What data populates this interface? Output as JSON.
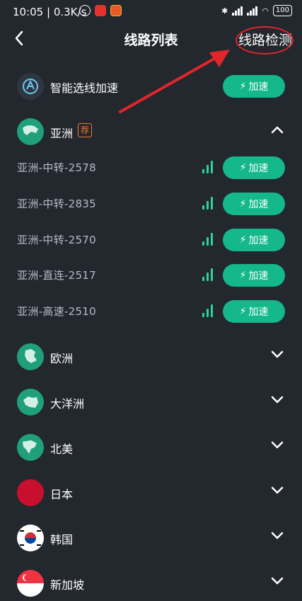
{
  "status_bar": {
    "time": "10:05",
    "speed": "0.3K/s",
    "battery": "100"
  },
  "header": {
    "title": "线路列表",
    "detect_label": "线路检测"
  },
  "smart": {
    "label": "智能选线加速",
    "button_label": "加速"
  },
  "regions": [
    {
      "label": "亚洲",
      "tag": "荐",
      "expanded": true,
      "lines": [
        {
          "label": "亚洲-中转-2578",
          "button_label": "加速"
        },
        {
          "label": "亚洲-中转-2835",
          "button_label": "加速"
        },
        {
          "label": "亚洲-中转-2570",
          "button_label": "加速"
        },
        {
          "label": "亚洲-直连-2517",
          "button_label": "加速"
        },
        {
          "label": "亚洲-高速-2510",
          "button_label": "加速"
        }
      ]
    },
    {
      "label": "欧洲",
      "expanded": false
    },
    {
      "label": "大洋洲",
      "expanded": false
    },
    {
      "label": "北美",
      "expanded": false
    },
    {
      "label": "日本",
      "expanded": false
    },
    {
      "label": "韩国",
      "expanded": false
    },
    {
      "label": "新加坡",
      "expanded": false
    }
  ],
  "colors": {
    "background": "#23272e",
    "accent": "#14b88a",
    "annotation": "#e0262a"
  }
}
